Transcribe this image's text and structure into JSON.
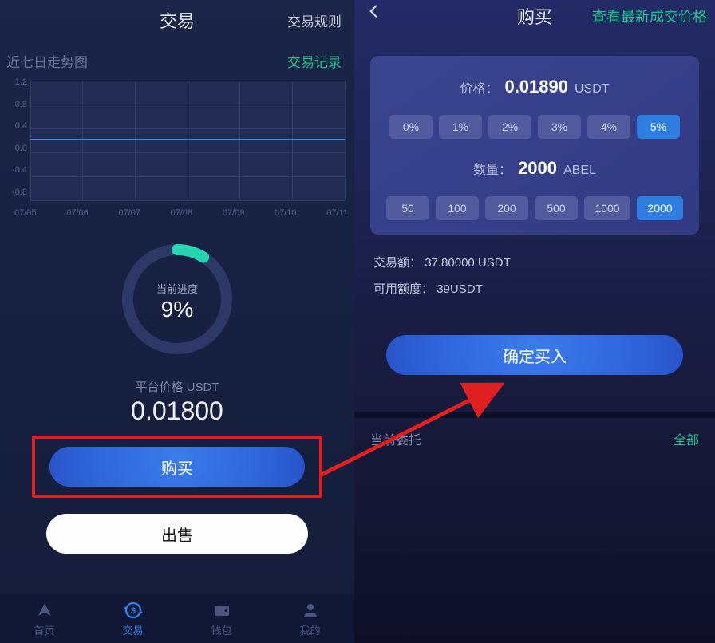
{
  "left": {
    "title": "交易",
    "rules_link": "交易规则",
    "trend_label": "近七日走势图",
    "records_link": "交易记录",
    "progress_label": "当前进度",
    "progress_percent": "9%",
    "platform_price_label": "平台价格 USDT",
    "platform_price": "0.01800",
    "buy_button": "购买",
    "sell_button": "出售"
  },
  "chart_data": {
    "type": "line",
    "title": "近七日走势图",
    "x_categories": [
      "07/05",
      "07/06",
      "07/07",
      "07/08",
      "07/09",
      "07/10",
      "07/11"
    ],
    "values": [
      0.018,
      0.018,
      0.018,
      0.018,
      0.018,
      0.018,
      0.018
    ],
    "y_ticks": [
      "1.2",
      "0.8",
      "0.4",
      "0.0",
      "-0.4",
      "-0.8"
    ],
    "ylim": [
      -0.8,
      1.2
    ],
    "xlabel": "",
    "ylabel": ""
  },
  "tabs": [
    {
      "label": "首页",
      "active": false
    },
    {
      "label": "交易",
      "active": true
    },
    {
      "label": "钱包",
      "active": false
    },
    {
      "label": "我的",
      "active": false
    }
  ],
  "right": {
    "title": "购买",
    "latest_link": "查看最新成交价格",
    "price_label": "价格：",
    "price_value": "0.01890",
    "price_unit": "USDT",
    "pct_options": [
      "0%",
      "1%",
      "2%",
      "3%",
      "4%",
      "5%"
    ],
    "pct_selected": "5%",
    "qty_label": "数量：",
    "qty_value": "2000",
    "qty_unit": "ABEL",
    "qty_options": [
      "50",
      "100",
      "200",
      "500",
      "1000",
      "2000"
    ],
    "qty_selected": "2000",
    "trade_amount_label": "交易额：",
    "trade_amount_value": "37.80000 USDT",
    "available_label": "可用额度：",
    "available_value": "39USDT",
    "confirm_button": "确定买入",
    "orders_label": "当前委托",
    "orders_all": "全部"
  }
}
